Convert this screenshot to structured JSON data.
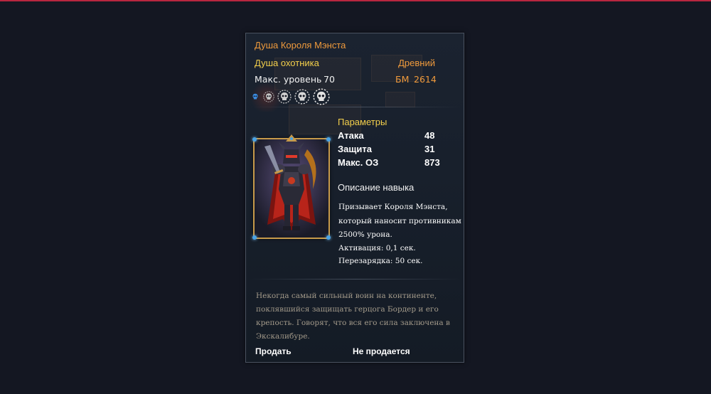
{
  "tooltip": {
    "title": "Душа Короля Мэнста",
    "type": "Душа охотника",
    "grade": "Древний",
    "max_level_label": "Макс. уровень",
    "max_level_value": "70",
    "bm_label": "БМ",
    "bm_value": "2614",
    "skull_icons": [
      {
        "name": "blue-skull-icon",
        "color": "#3a8be0"
      },
      {
        "name": "silver-skull-icon",
        "color": "#c4c4c4"
      },
      {
        "name": "silver-skull-icon",
        "color": "#cfcfcf"
      },
      {
        "name": "silver-skull-icon",
        "color": "#d8d8d8"
      },
      {
        "name": "silver-skull-icon",
        "color": "#e2e2e2"
      }
    ],
    "params": {
      "title": "Параметры",
      "stats": [
        {
          "name": "Атака",
          "value": "48"
        },
        {
          "name": "Защита",
          "value": "31"
        },
        {
          "name": "Макс. ОЗ",
          "value": "873"
        }
      ]
    },
    "skill": {
      "title": "Описание навыка",
      "lines": [
        "Призывает Короля Мэнста,",
        "который наносит  противникам",
        "2500% урона.",
        "Активация: 0,1 сек.",
        "Перезарядка: 50 сек."
      ]
    },
    "lore": "Некогда самый сильный воин на континенте, поклявшийся защищать герцога Бордер и его крепость. Говорят, что вся его сила заключена в Экскалибуре.",
    "sell_label": "Продать",
    "sell_value": "Не продается"
  },
  "colors": {
    "accent_orange": "#ef9a3c",
    "accent_yellow": "#f3cf4b",
    "frame_gold": "#c79a4a",
    "top_line": "#b8263f"
  }
}
